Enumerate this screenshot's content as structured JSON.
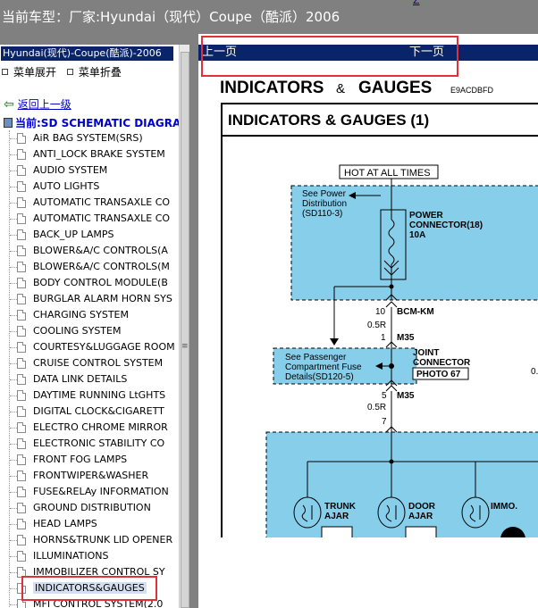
{
  "header": {
    "title": "当前车型：厂家:Hyundai（现代）Coupe（酷派）2006",
    "top_link": "Z"
  },
  "sidebar": {
    "vehicle_select": "Hyundai(现代)-Coupe(酷派)-2006",
    "expand_label": "菜单展开",
    "collapse_label": "菜单折叠",
    "back_label": "返回上一级",
    "current_label": "当前:SD SCHEMATIC DIAGRAM",
    "items": [
      {
        "label": "AiR BAG SYSTEM(SRS)"
      },
      {
        "label": "ANTI_LOCK BRAKE SYSTEM"
      },
      {
        "label": "AUDIO SYSTEM"
      },
      {
        "label": "AUTO LIGHTS"
      },
      {
        "label": "AUTOMATIC TRANSAXLE CO"
      },
      {
        "label": "AUTOMATIC TRANSAXLE CO"
      },
      {
        "label": "BACK_UP LAMPS"
      },
      {
        "label": "BLOWER&A/C CONTROLS(A"
      },
      {
        "label": "BLOWER&A/C CONTROLS(M"
      },
      {
        "label": "BODY CONTROL MODULE(B"
      },
      {
        "label": "BURGLAR ALARM HORN SYS"
      },
      {
        "label": "CHARGING SYSTEM"
      },
      {
        "label": "COOLING SYSTEM"
      },
      {
        "label": "COURTESY&LUGGAGE ROOM"
      },
      {
        "label": "CRUISE CONTROL SYSTEM"
      },
      {
        "label": "DATA LINK DETAILS"
      },
      {
        "label": "DAYTIME RUNNING LtGHTS"
      },
      {
        "label": "DIGITAL CLOCK&CIGARETT"
      },
      {
        "label": "ELECTRO CHROME MIRROR"
      },
      {
        "label": "ELECTRONIC STABILITY CO"
      },
      {
        "label": "FRONT FOG LAMPS"
      },
      {
        "label": "FRONTWIPER&WASHER"
      },
      {
        "label": "FUSE&RELAy INFORMATION"
      },
      {
        "label": "GROUND DISTRIBUTION"
      },
      {
        "label": "HEAD LAMPS"
      },
      {
        "label": "HORNS&TRUNK LID OPENER"
      },
      {
        "label": "ILLUMINATIONS"
      },
      {
        "label": "IMMOBILIZER CONTROL SY"
      },
      {
        "label": "INDICATORS&GAUGES"
      },
      {
        "label": "MFI CONTROL SYSTEM(2.0"
      }
    ],
    "selected_index": 28
  },
  "content": {
    "prev_label": "上一页",
    "next_label": "下一页",
    "diagram": {
      "heading": "INDICATORS",
      "heading_amp": "&",
      "heading2": "GAUGES",
      "code": "E9ACDBFD",
      "subheading": "INDICATORS & GAUGES (1)",
      "hot_label": "HOT AT ALL TIMES",
      "see_power_1": "See Power",
      "see_power_2": "Distribution",
      "see_power_3": "(SD110-3)",
      "power_connector_1": "POWER",
      "power_connector_2": "CONNECTOR(18)",
      "power_connector_3": "10A",
      "pin_10": "10",
      "bcm_km": "BCM-KM",
      "wire_05r_a": "0.5R",
      "pin_1": "1",
      "m35_a": "M35",
      "see_pass_1": "See Passenger",
      "see_pass_2": "Compartment Fuse",
      "see_pass_3": "Details(SD120-5)",
      "joint_1": "JOINT",
      "joint_2": "CONNECTOR",
      "photo": "PHOTO 67",
      "right_cut": "0.",
      "pin_5": "5",
      "m35_b": "M35",
      "wire_05r_b": "0.5R",
      "pin_7": "7",
      "trunk_1": "TRUNK",
      "trunk_2": "AJAR",
      "door_1": "DOOR",
      "door_2": "AJAR",
      "immo": "IMMO."
    }
  },
  "colors": {
    "panel_blue": "#0a246a",
    "highlight_red": "#e0303a",
    "diagram_cyan": "#87ceeb",
    "link_blue": "#0000cc"
  }
}
